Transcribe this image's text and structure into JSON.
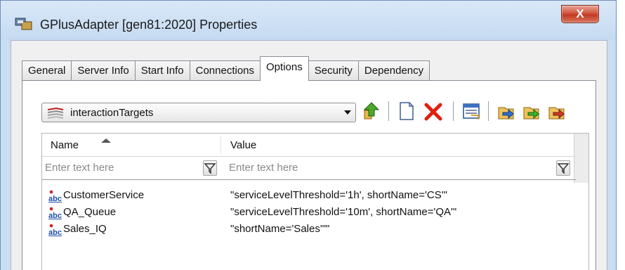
{
  "window": {
    "title": "GPlusAdapter [gen81:2020] Properties",
    "close_label": "X"
  },
  "tabs": [
    {
      "label": "General",
      "active": false
    },
    {
      "label": "Server Info",
      "active": false
    },
    {
      "label": "Start Info",
      "active": false
    },
    {
      "label": "Connections",
      "active": false
    },
    {
      "label": "Options",
      "active": true
    },
    {
      "label": "Security",
      "active": false
    },
    {
      "label": "Dependency",
      "active": false
    }
  ],
  "section_select": {
    "value": "interactionTargets"
  },
  "toolbar": {
    "icons": [
      "up-folder-icon",
      "new-item-icon",
      "delete-icon",
      "properties-icon",
      "import-icon",
      "export-icon",
      "export-all-icon"
    ]
  },
  "grid": {
    "columns": {
      "name": "Name",
      "value": "Value"
    },
    "filters": {
      "name_placeholder": "Enter text here",
      "value_placeholder": "Enter text here"
    },
    "rows": [
      {
        "icon": "abc",
        "name": "CustomerService",
        "value": "\"serviceLevelThreshold='1h', shortName='CS'\""
      },
      {
        "icon": "abc",
        "name": "QA_Queue",
        "value": "\"serviceLevelThreshold='10m', shortName='QA'\""
      },
      {
        "icon": "abc",
        "name": "Sales_IQ",
        "value": "\"shortName='Sales'\"\""
      }
    ]
  },
  "colors": {
    "titlebar": "#c9ddf3",
    "close": "#c03a23",
    "delete": "#e02010"
  }
}
